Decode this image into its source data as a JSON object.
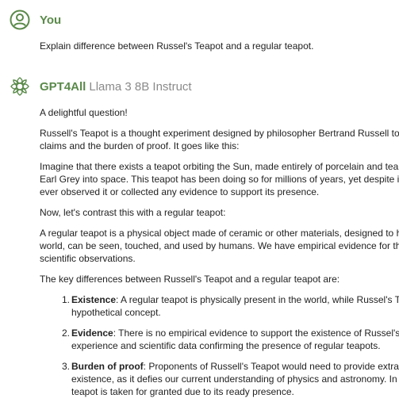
{
  "user": {
    "name": "You",
    "message": "Explain difference between Russel's Teapot and a regular teapot."
  },
  "assistant": {
    "name": "GPT4All",
    "model": "Llama 3 8B Instruct",
    "paragraphs": [
      "A delightful question!",
      [
        "Russell's Teapot is a thought experiment designed by philosopher Bertrand Russell to il",
        "claims and the burden of proof. It goes like this:"
      ],
      [
        "Imagine that there exists a teapot orbiting the Sun, made entirely of porcelain and tea l",
        "Earl Grey into space. This teapot has been doing so for millions of years, yet despite its",
        "ever observed it or collected any evidence to support its presence."
      ],
      "Now, let's contrast this with a regular teapot:",
      [
        "A regular teapot is a physical object made of ceramic or other materials, designed to ho",
        "world, can be seen, touched, and used by humans. We have empirical evidence for the",
        "scientific observations."
      ],
      "The key differences between Russell's Teapot and a regular teapot are:"
    ],
    "list": [
      {
        "num": "1.",
        "term": "Existence",
        "lines": [
          ": A regular teapot is physically present in the world, while Russel's Tea",
          "hypothetical concept."
        ]
      },
      {
        "num": "2.",
        "term": "Evidence",
        "lines": [
          ": There is no empirical evidence to support the existence of Russel's Te",
          "experience and scientific data confirming the presence of regular teapots."
        ]
      },
      {
        "num": "3.",
        "term": "Burden of proof",
        "lines": [
          ": Proponents of Russell's Teapot would need to provide extraor",
          "existence, as it defies our current understanding of physics and astronomy. In c",
          "teapot is taken for granted due to its ready presence."
        ]
      }
    ]
  },
  "colors": {
    "accent": "#5a8a4a",
    "muted": "#8a8a8a"
  },
  "icons": {
    "user": "user-avatar-icon",
    "assistant": "gpt4all-logo-icon"
  }
}
